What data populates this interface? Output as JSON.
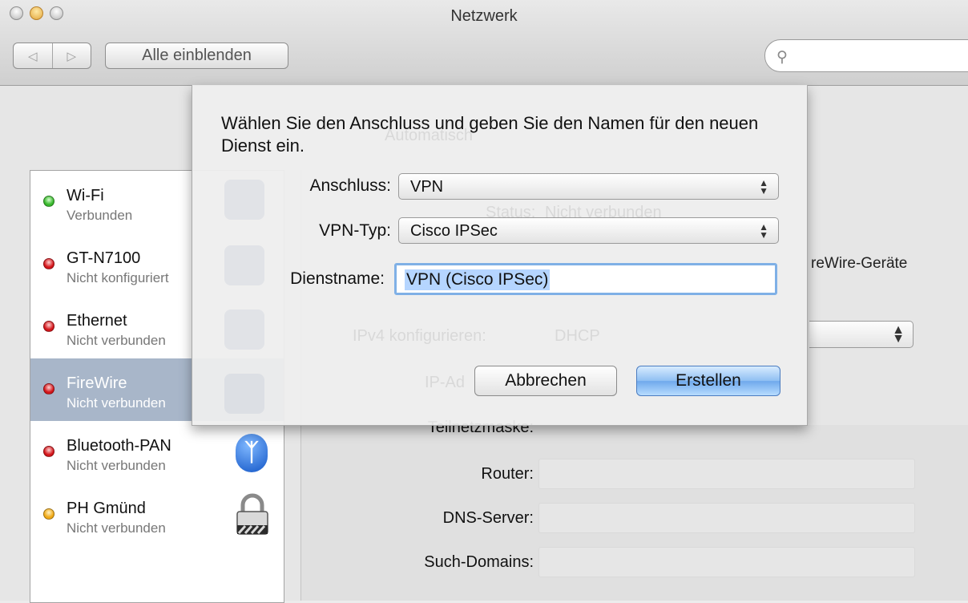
{
  "window": {
    "title": "Netzwerk"
  },
  "toolbar": {
    "back": "◁",
    "forward": "▷",
    "show_all": "Alle einblenden",
    "search_placeholder": ""
  },
  "services": [
    {
      "name": "Wi-Fi",
      "status": "Verbunden",
      "color": "green"
    },
    {
      "name": "GT-N7100",
      "status": "Nicht konfiguriert",
      "color": "red"
    },
    {
      "name": "Ethernet",
      "status": "Nicht verbunden",
      "color": "red"
    },
    {
      "name": "FireWire",
      "status": "Nicht verbunden",
      "color": "red",
      "selected": true
    },
    {
      "name": "Bluetooth-PAN",
      "status": "Nicht verbunden",
      "color": "red",
      "icon": "bluetooth-icon"
    },
    {
      "name": "PH Gmünd",
      "status": "Nicht verbunden",
      "color": "yellow",
      "icon": "lock-icon"
    }
  ],
  "detail": {
    "firewire_text": "reWire-Geräte",
    "labels": {
      "subnet": "Teilnetzmaske:",
      "router": "Router:",
      "dns": "DNS-Server:",
      "domains": "Such-Domains:"
    },
    "ghost": {
      "status": "Status:",
      "status_value": "Nicht verbunden",
      "ipv4": "IPv4 konfigurieren:",
      "ipv4_value": "DHCP",
      "ip": "IP-Ad",
      "location": "Automatisch"
    }
  },
  "sheet": {
    "prompt": "Wählen Sie den Anschluss und geben Sie den Namen für den neuen Dienst ein.",
    "interface_label": "Anschluss:",
    "interface_value": "VPN",
    "vpn_type_label": "VPN-Typ:",
    "vpn_type_value": "Cisco IPSec",
    "service_name_label": "Dienstname:",
    "service_name_value": "VPN (Cisco IPSec)",
    "cancel": "Abbrechen",
    "create": "Erstellen"
  },
  "colors": {
    "selection": "#a8b6c9",
    "default_button": "#6fa9ec",
    "focus_ring": "#7fb0e6"
  }
}
